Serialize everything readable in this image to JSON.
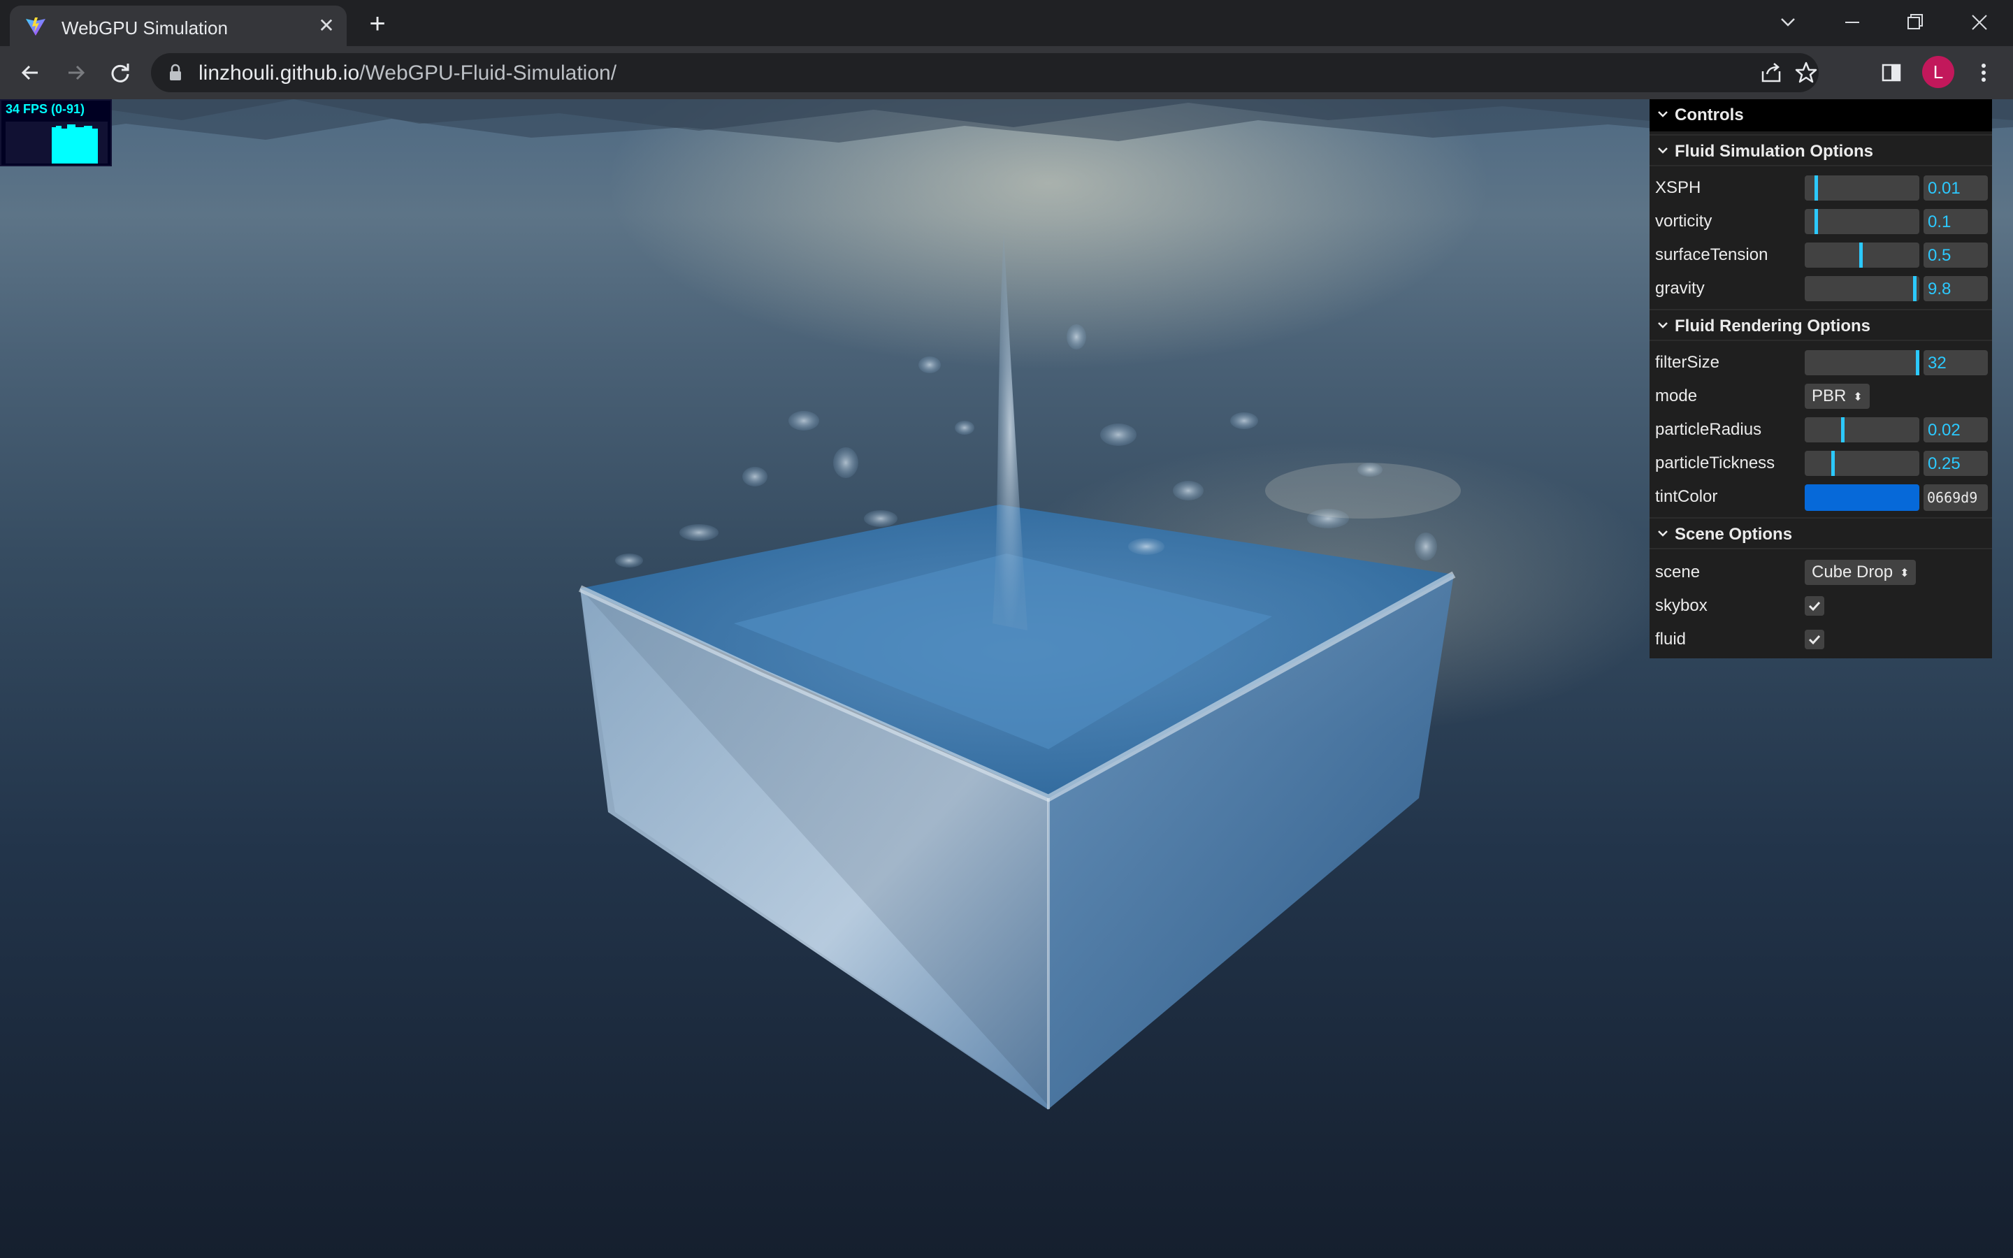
{
  "browser": {
    "tab": {
      "title": "WebGPU Simulation",
      "favicon": "vite-logo-icon"
    },
    "url": {
      "host": "linzhouli.github.io",
      "path": "/WebGPU-Fluid-Simulation/"
    },
    "profile_initial": "L",
    "colors": {
      "frame": "#202124",
      "toolbar": "#35363a",
      "avatar": "#c2185b"
    }
  },
  "stats": {
    "label": "34 FPS (0-91)",
    "color": "#00ffff"
  },
  "gui": {
    "title": "Controls",
    "accent": "#2cc9ff",
    "folders": {
      "simulation": {
        "label": "Fluid Simulation Options",
        "controls": [
          {
            "label": "XSPH",
            "value": "0.01",
            "level": 0.02
          },
          {
            "label": "vorticity",
            "value": "0.1",
            "level": 0.02
          },
          {
            "label": "surfaceTension",
            "value": "0.5",
            "level": 0.45
          },
          {
            "label": "gravity",
            "value": "9.8",
            "level": 0.98
          }
        ]
      },
      "rendering": {
        "label": "Fluid Rendering Options",
        "filterSize": {
          "label": "filterSize",
          "value": "32",
          "level": 0.99
        },
        "mode": {
          "label": "mode",
          "value": "PBR"
        },
        "particleRadius": {
          "label": "particleRadius",
          "value": "0.02",
          "level": 0.3
        },
        "particleTickness": {
          "label": "particleTickness",
          "value": "0.25",
          "level": 0.2
        },
        "tintColor": {
          "label": "tintColor",
          "value": "0669d9",
          "color": "#0669d9"
        }
      },
      "scene": {
        "label": "Scene Options",
        "scene": {
          "label": "scene",
          "value": "Cube Drop"
        },
        "skybox": {
          "label": "skybox",
          "checked": true
        },
        "fluid": {
          "label": "fluid",
          "checked": true
        }
      }
    }
  }
}
